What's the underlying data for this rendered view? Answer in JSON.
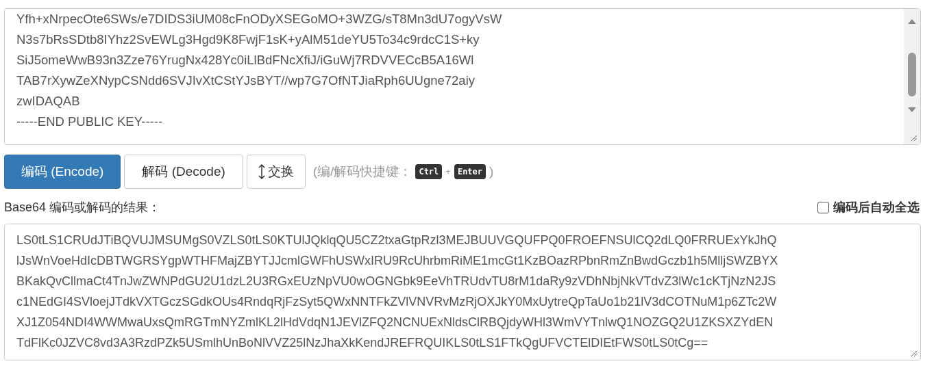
{
  "input": {
    "lines": [
      "Yfh+xNrpecOte6SWs/e7DIDS3iUM08cFnODyXSEGoMO+3WZG/sT8Mn3dU7ogyVsW",
      "N3s7bRsSDtb8IYhz2SvEWLg3Hgd9K8FwjF1sK+yAlM51deYU5To34c9rdcC1S+ky",
      "SiJ5omeWwB93n3Zze76YrugNx428Yc0iLlBdFNcXfiJ/iGuWj7RDVVECcB5A16Wl",
      "TAB7rXywZeXNypCSNdd6SVJIvXtCStYJsBYT//wp7G7OfNTJiaRph6UUgne72aiy",
      "zwIDAQAB",
      "-----END PUBLIC KEY-----"
    ]
  },
  "buttons": [
    {
      "kind": "primary",
      "label": "编码 (Encode)"
    },
    {
      "kind": "default",
      "label": "解码 (Decode)"
    },
    {
      "kind": "swap",
      "label": "交换"
    }
  ],
  "shortcut": {
    "prefix": "(编/解码快捷键：",
    "keys": [
      "Ctrl",
      "Enter"
    ],
    "plus": "+",
    "suffix": ")"
  },
  "result_label": "Base64 编码或解码的结果：",
  "auto_select": {
    "label": "编码后自动全选",
    "checked": false
  },
  "output": {
    "lines": [
      "LS0tLS1CRUdJTiBQVUJMSUMgS0VZLS0tLS0KTUlJQklqQU5CZ2txaGtpRzl3MEJBUUVGQUFPQ0FROEFNSUlCQ2dLQ0FRRUExYkJhQ",
      "lJsWnVoeHdIcDBTWGRSYgpWTHFMajZBYTJJcmlGWFhUSWxIRU9RcUhrbmRiME1mcGt1KzBOazRPbnRmZnBwdGczb1h5MlljSWZBYX",
      "BKakQvCllmaCt4TnJwZWNPdGU2U1dzL2U3RGxEUzNpVU0wOGNGbk9EeVhTRUdvTU8rM1daRy9zVDhNbjNkVTdvZ3lWc1cKTjNzN2JS",
      "c1NEdGI4SVloejJTdkVXTGczSGdkOUs4RndqRjFzSyt5QWxNNTFkZVlVNVRvMzRjOXJkY0MxUytreQpTaUo1b21lV3dCOTNuM1p6ZTc2W",
      "XJ1Z054NDI4WWMwaUxsQmRGTmNYZmlKL2lHdVdqN1JEVlZFQ2NCNUExNldsClRBQjdyWHl3WmVYTnlwQ1NOZGQ2U1ZKSXZYdEN",
      "TdFlKc0JZVC8vd3A3RzdPZk5USmlhUnBoNlVVZ25lNzJhaXkKendJREFRQUIKLS0tLS1FTkQgUFVCTElDIEtFWS0tLS0tCg=="
    ]
  }
}
